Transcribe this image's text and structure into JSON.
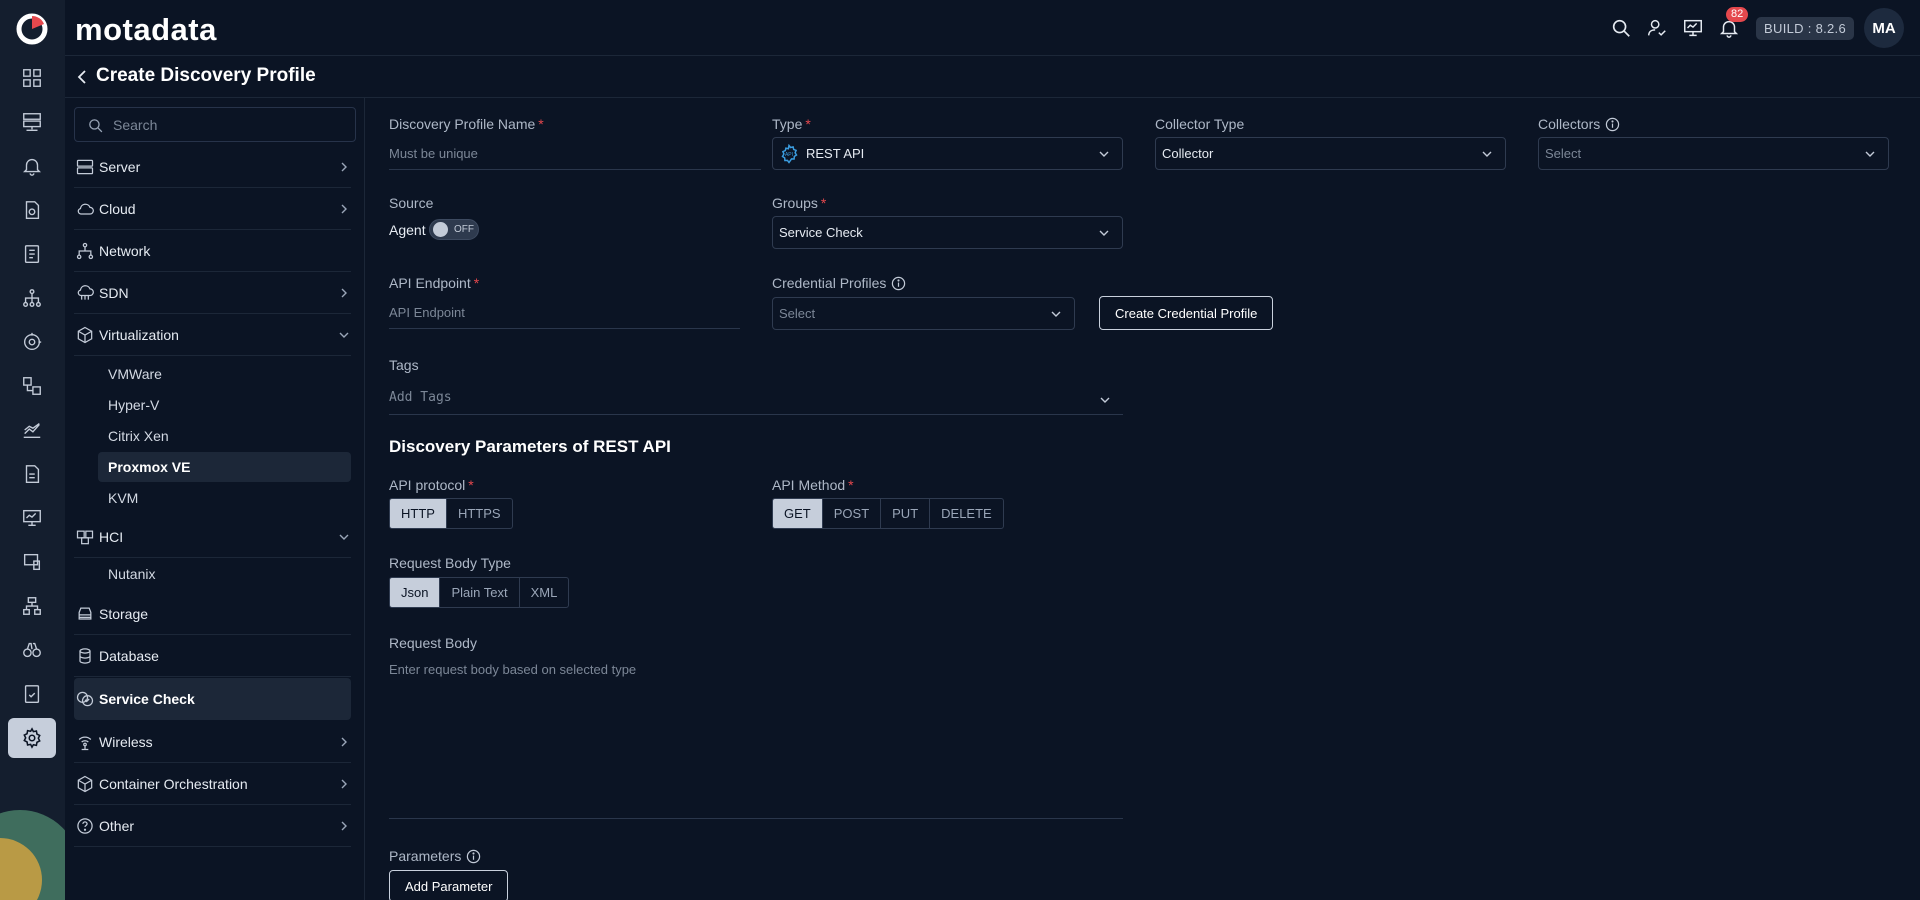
{
  "app": {
    "brand": "motadata",
    "build": "BUILD : 8.2.6",
    "avatar": "MA",
    "notifications": "82"
  },
  "page": {
    "title": "Create Discovery Profile"
  },
  "sidebar": {
    "search_placeholder": "Search",
    "categories": [
      {
        "label": "Server"
      },
      {
        "label": "Cloud"
      },
      {
        "label": "Network"
      },
      {
        "label": "SDN"
      },
      {
        "label": "Virtualization"
      },
      {
        "label": "HCI"
      },
      {
        "label": "Storage"
      },
      {
        "label": "Database"
      },
      {
        "label": "Service Check"
      },
      {
        "label": "Wireless"
      },
      {
        "label": "Container Orchestration"
      },
      {
        "label": "Other"
      }
    ],
    "virtualization_items": [
      "VMWare",
      "Hyper-V",
      "Citrix Xen",
      "Proxmox VE",
      "KVM"
    ],
    "hci_items": [
      "Nutanix"
    ]
  },
  "form": {
    "profile_name": {
      "label": "Discovery Profile Name",
      "placeholder": "Must be unique"
    },
    "type": {
      "label": "Type",
      "value": "REST API"
    },
    "collector_type": {
      "label": "Collector Type",
      "value": "Collector"
    },
    "collectors": {
      "label": "Collectors",
      "value": "Select"
    },
    "source": {
      "label": "Source",
      "agent_label": "Agent",
      "toggle_text": "OFF"
    },
    "groups": {
      "label": "Groups",
      "value": "Service Check"
    },
    "api_endpoint": {
      "label": "API Endpoint",
      "placeholder": "API Endpoint"
    },
    "credential_profiles": {
      "label": "Credential Profiles",
      "value": "Select",
      "create_button": "Create Credential Profile"
    },
    "tags": {
      "label": "Tags",
      "placeholder": "Add Tags"
    },
    "section_title": "Discovery Parameters of REST API",
    "api_protocol": {
      "label": "API protocol",
      "options": [
        "HTTP",
        "HTTPS"
      ],
      "selected": "HTTP"
    },
    "api_method": {
      "label": "API Method",
      "options": [
        "GET",
        "POST",
        "PUT",
        "DELETE"
      ],
      "selected": "GET"
    },
    "request_body_type": {
      "label": "Request Body Type",
      "options": [
        "Json",
        "Plain Text",
        "XML"
      ],
      "selected": "Json"
    },
    "request_body": {
      "label": "Request Body",
      "placeholder": "Enter request body based on selected type"
    },
    "parameters": {
      "label": "Parameters",
      "add_button": "Add Parameter"
    }
  },
  "colors": {
    "background": "#0b1424",
    "rail": "#141e2e",
    "accent_selected": "#c6cedb",
    "required": "#e5484d",
    "badge": "#e5484d"
  }
}
